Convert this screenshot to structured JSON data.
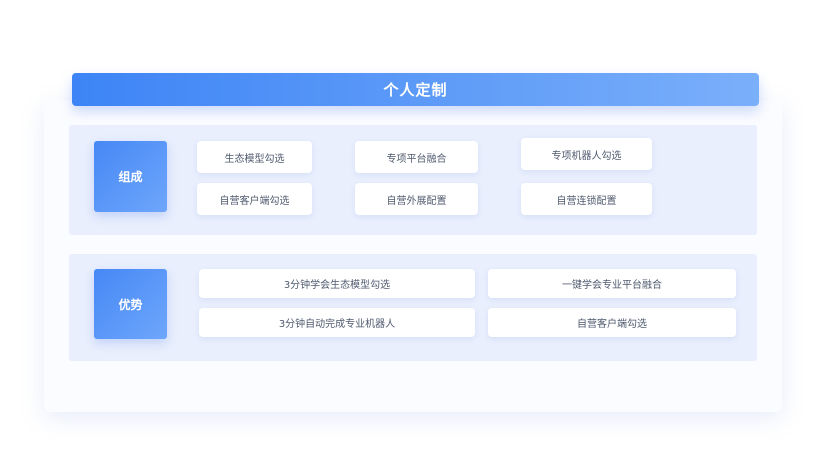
{
  "title": "个人定制",
  "composition": {
    "label": "组成",
    "items": [
      "生态模型勾选",
      "专项平台融合",
      "专项机器人勾选",
      "自营客户端勾选",
      "自营外展配置",
      "自营连锁配置"
    ]
  },
  "advantages": {
    "label": "优势",
    "items": [
      "3分钟学会生态模型勾选",
      "一键学会专业平台融合",
      "3分钟自动完成专业机器人",
      "自营客户端勾选"
    ]
  },
  "colors": {
    "accent": "#3d84f6",
    "section_bg": "#e9effd",
    "chip_text": "#4f5a6e"
  }
}
